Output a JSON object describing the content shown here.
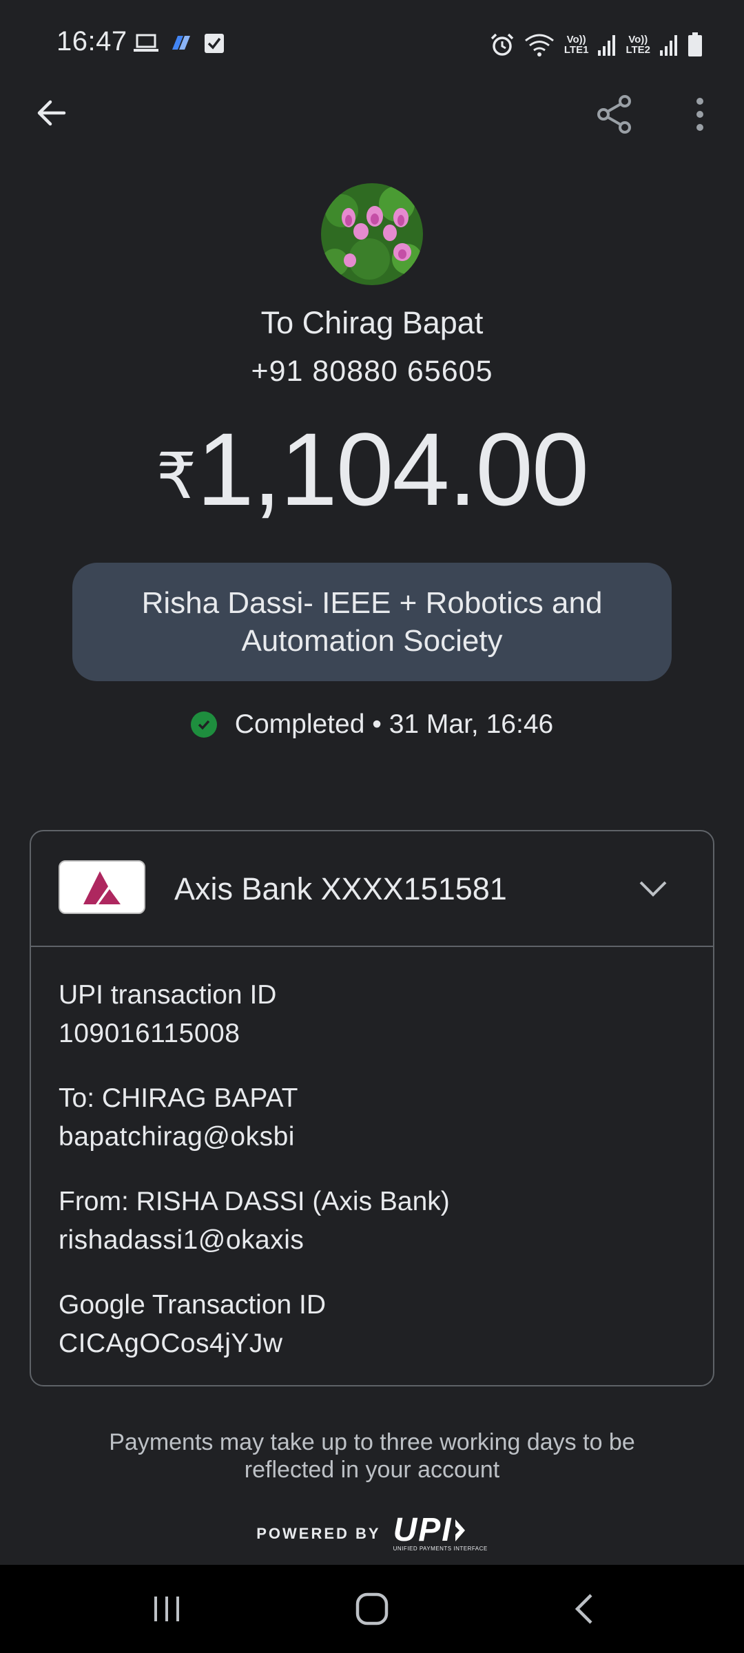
{
  "status_bar": {
    "time": "16:47",
    "lte1": "LTE1",
    "lte2": "LTE2",
    "volte": "Vo))"
  },
  "header": {
    "back_icon": "arrow-left-icon",
    "share_icon": "share-icon",
    "more_icon": "more-vertical-icon"
  },
  "payee": {
    "title": "To Chirag Bapat",
    "phone": "+91 80880 65605"
  },
  "amount": {
    "currency": "₹",
    "value": "1,104.00"
  },
  "note": "Risha Dassi- IEEE + Robotics and Automation Society",
  "status": {
    "text": "Completed • 31 Mar, 16:46",
    "color": "#1e8e3e"
  },
  "bank": {
    "name": "Axis Bank XXXX151581",
    "logo_color": "#ae275f"
  },
  "details": [
    {
      "label": "UPI transaction ID",
      "value": "109016115008"
    },
    {
      "label": "To: CHIRAG  BAPAT",
      "value": "bapatchirag@oksbi"
    },
    {
      "label": "From: RISHA DASSI (Axis Bank)",
      "value": "rishadassi1@okaxis"
    },
    {
      "label": "Google Transaction ID",
      "value": "CICAgOCos4jYJw"
    }
  ],
  "footer": {
    "note": "Payments may take up to three working days to be reflected in your account",
    "powered_by": "POWERED BY",
    "upi_logo": "UPI",
    "upi_sub": "UNIFIED PAYMENTS INTERFACE"
  },
  "nav": {
    "recents_icon": "recents-icon",
    "home_icon": "home-icon",
    "back_icon": "back-chevron-icon"
  }
}
